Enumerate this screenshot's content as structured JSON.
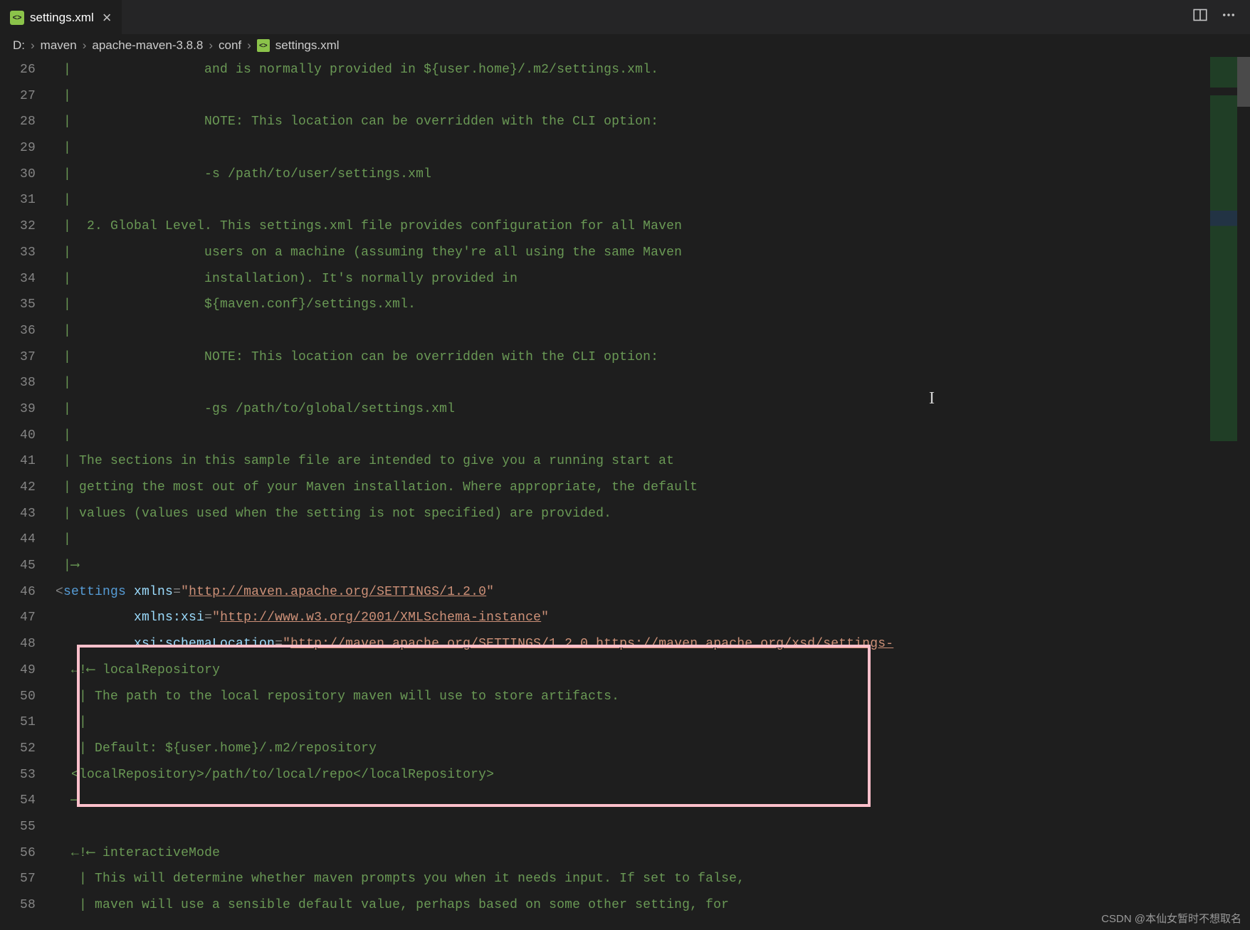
{
  "tab": {
    "title": "settings.xml"
  },
  "breadcrumbs": [
    "D:",
    "maven",
    "apache-maven-3.8.8",
    "conf",
    "settings.xml"
  ],
  "actions": {
    "split": "split-editor",
    "more": "more-actions"
  },
  "watermark": "CSDN @本仙女暂时不想取名",
  "lines": [
    {
      "n": 26,
      "segs": [
        [
          "c-comment",
          " |                 and is normally provided in ${user.home}/.m2/settings.xml."
        ]
      ]
    },
    {
      "n": 27,
      "segs": [
        [
          "c-comment",
          " |"
        ]
      ]
    },
    {
      "n": 28,
      "segs": [
        [
          "c-comment",
          " |                 NOTE: This location can be overridden with the CLI option:"
        ]
      ]
    },
    {
      "n": 29,
      "segs": [
        [
          "c-comment",
          " |"
        ]
      ]
    },
    {
      "n": 30,
      "segs": [
        [
          "c-comment",
          " |                 -s /path/to/user/settings.xml"
        ]
      ]
    },
    {
      "n": 31,
      "segs": [
        [
          "c-comment",
          " |"
        ]
      ]
    },
    {
      "n": 32,
      "segs": [
        [
          "c-comment",
          " |  2. Global Level. This settings.xml file provides configuration for all Maven"
        ]
      ]
    },
    {
      "n": 33,
      "segs": [
        [
          "c-comment",
          " |                 users on a machine (assuming they're all using the same Maven"
        ]
      ]
    },
    {
      "n": 34,
      "segs": [
        [
          "c-comment",
          " |                 installation). It's normally provided in"
        ]
      ]
    },
    {
      "n": 35,
      "segs": [
        [
          "c-comment",
          " |                 ${maven.conf}/settings.xml."
        ]
      ]
    },
    {
      "n": 36,
      "segs": [
        [
          "c-comment",
          " |"
        ]
      ]
    },
    {
      "n": 37,
      "segs": [
        [
          "c-comment",
          " |                 NOTE: This location can be overridden with the CLI option:"
        ]
      ]
    },
    {
      "n": 38,
      "segs": [
        [
          "c-comment",
          " |"
        ]
      ]
    },
    {
      "n": 39,
      "segs": [
        [
          "c-comment",
          " |                 -gs /path/to/global/settings.xml"
        ]
      ]
    },
    {
      "n": 40,
      "segs": [
        [
          "c-comment",
          " |"
        ]
      ]
    },
    {
      "n": 41,
      "segs": [
        [
          "c-comment",
          " | The sections in this sample file are intended to give you a running start at"
        ]
      ]
    },
    {
      "n": 42,
      "segs": [
        [
          "c-comment",
          " | getting the most out of your Maven installation. Where appropriate, the default"
        ]
      ]
    },
    {
      "n": 43,
      "segs": [
        [
          "c-comment",
          " | values (values used when the setting is not specified) are provided."
        ]
      ]
    },
    {
      "n": 44,
      "segs": [
        [
          "c-comment",
          " |"
        ]
      ]
    },
    {
      "n": 45,
      "segs": [
        [
          "c-comment",
          " |⟶"
        ]
      ]
    },
    {
      "n": 46,
      "segs": [
        [
          "c-delim",
          "<"
        ],
        [
          "c-tag",
          "settings"
        ],
        [
          "c-text",
          " "
        ],
        [
          "c-attr",
          "xmlns"
        ],
        [
          "c-delim",
          "="
        ],
        [
          "c-str",
          "\""
        ],
        [
          "c-url",
          "http://maven.apache.org/SETTINGS/1.2.0"
        ],
        [
          "c-str",
          "\""
        ]
      ]
    },
    {
      "n": 47,
      "segs": [
        [
          "c-text",
          "          "
        ],
        [
          "c-attr",
          "xmlns:xsi"
        ],
        [
          "c-delim",
          "="
        ],
        [
          "c-str",
          "\""
        ],
        [
          "c-url",
          "http://www.w3.org/2001/XMLSchema-instance"
        ],
        [
          "c-str",
          "\""
        ]
      ]
    },
    {
      "n": 48,
      "segs": [
        [
          "c-text",
          "          "
        ],
        [
          "c-attr",
          "xsi:schemaLocation"
        ],
        [
          "c-delim",
          "="
        ],
        [
          "c-str",
          "\""
        ],
        [
          "c-url",
          "http://maven.apache.org/SETTINGS/1.2.0 https://maven.apache.org/xsd/settings-"
        ]
      ]
    },
    {
      "n": 49,
      "segs": [
        [
          "c-comment",
          "  ←!⟵ localRepository"
        ]
      ]
    },
    {
      "n": 50,
      "segs": [
        [
          "c-comment",
          "   | The path to the local repository maven will use to store artifacts."
        ]
      ]
    },
    {
      "n": 51,
      "segs": [
        [
          "c-comment",
          "   |"
        ]
      ]
    },
    {
      "n": 52,
      "segs": [
        [
          "c-comment",
          "   | Default: ${user.home}/.m2/repository"
        ]
      ]
    },
    {
      "n": 53,
      "segs": [
        [
          "c-comment",
          "  <localRepository>/path/to/local/repo</localRepository>"
        ]
      ]
    },
    {
      "n": 54,
      "segs": [
        [
          "c-comment",
          "  ⟶"
        ]
      ]
    },
    {
      "n": 55,
      "segs": []
    },
    {
      "n": 56,
      "segs": [
        [
          "c-comment",
          "  ←!⟵ interactiveMode"
        ]
      ]
    },
    {
      "n": 57,
      "segs": [
        [
          "c-comment",
          "   | This will determine whether maven prompts you when it needs input. If set to false,"
        ]
      ]
    },
    {
      "n": 58,
      "segs": [
        [
          "c-comment",
          "   | maven will use a sensible default value, perhaps based on some other setting, for"
        ]
      ]
    }
  ]
}
